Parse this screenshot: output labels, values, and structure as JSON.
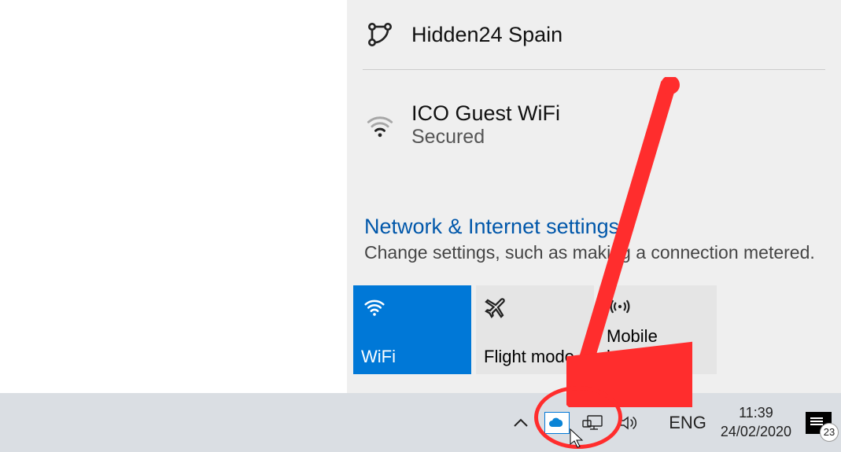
{
  "networks": [
    {
      "name": "Hidden24 Spain",
      "status": "",
      "type": "vpn"
    },
    {
      "name": "ICO Guest WiFi",
      "status": "Secured",
      "type": "wifi"
    }
  ],
  "settings_link": {
    "title": "Network & Internet settings",
    "subtitle": "Change settings, such as making a connection metered."
  },
  "tiles": [
    {
      "label": "WiFi",
      "active": true,
      "icon": "wifi"
    },
    {
      "label": "Flight mode",
      "active": false,
      "icon": "airplane"
    },
    {
      "label": "Mobile hotspot",
      "active": false,
      "icon": "hotspot"
    }
  ],
  "taskbar": {
    "language": "ENG",
    "time": "11:39",
    "date": "24/02/2020",
    "notifications_count": "23"
  },
  "annotation": {
    "arrow_color": "#ff2d2d"
  }
}
